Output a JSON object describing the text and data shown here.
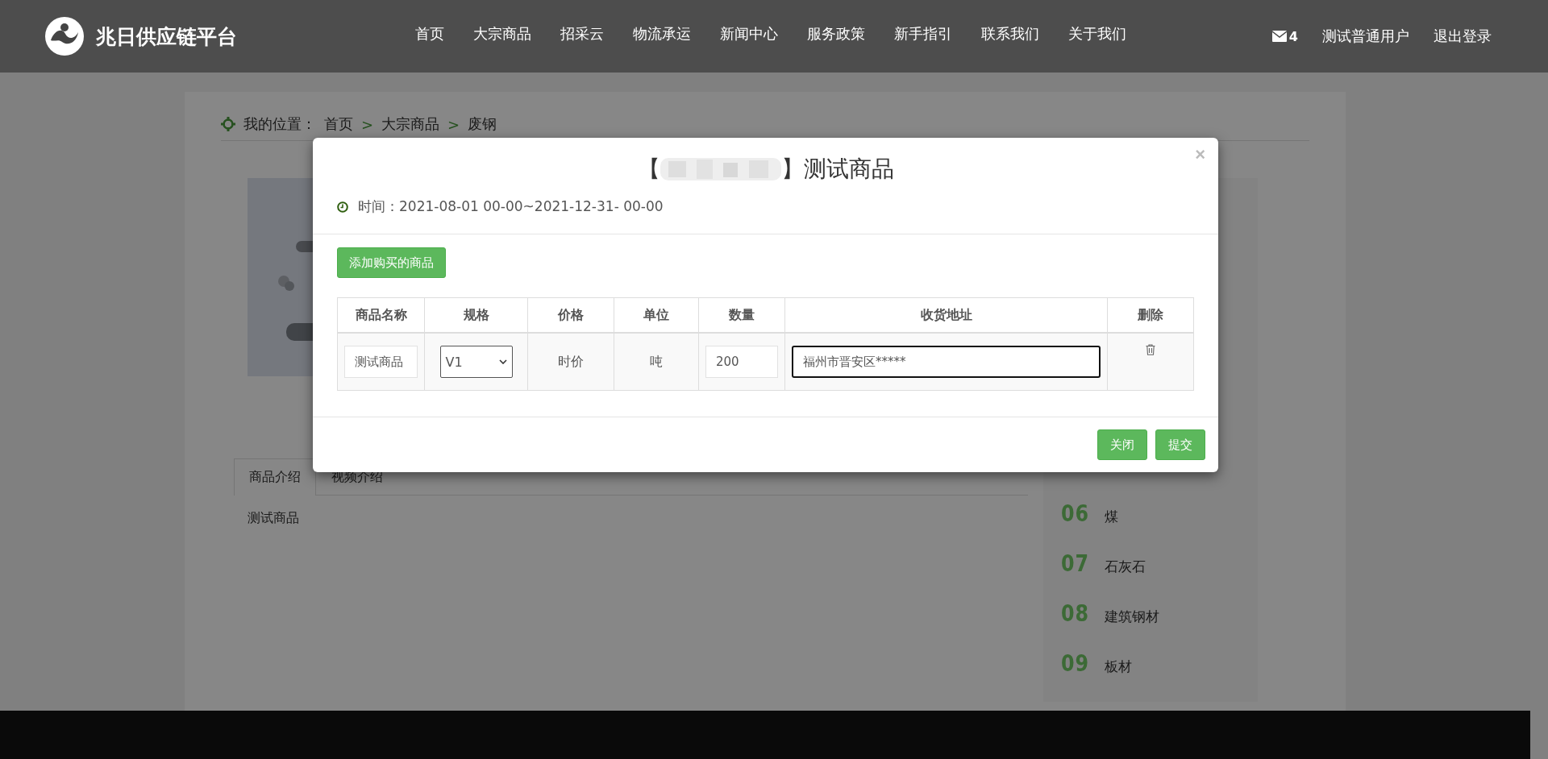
{
  "header": {
    "brand": "兆日供应链平台",
    "nav": [
      "首页",
      "大宗商品",
      "招采云",
      "物流承运",
      "新闻中心",
      "服务政策",
      "新手指引",
      "联系我们",
      "关于我们"
    ],
    "message_count": "4",
    "user": "测试普通用户",
    "logout": "退出登录"
  },
  "page": {
    "breadcrumb": {
      "label": "我的位置：",
      "trail": [
        {
          "kind": "link",
          "text": "首页"
        },
        {
          "kind": "separator",
          "text": ">"
        },
        {
          "kind": "link",
          "text": "大宗商品"
        },
        {
          "kind": "separator",
          "text": ">"
        },
        {
          "kind": "link",
          "text": "废钢"
        }
      ]
    },
    "detail_tabs": [
      {
        "label": "商品介绍",
        "selected": true
      },
      {
        "label": "视频介绍",
        "selected": false
      }
    ],
    "description": "测试商品",
    "category_list": [
      {
        "number": "06",
        "name": "煤"
      },
      {
        "number": "07",
        "name": "石灰石"
      },
      {
        "number": "08",
        "name": "建筑钢材"
      },
      {
        "number": "09",
        "name": "板材"
      }
    ]
  },
  "modal": {
    "title_open": "【",
    "title_close": "】测试商品",
    "close": "×",
    "time": "时间：2021-08-01 00-00~2021-12-31- 00-00",
    "add_button": "添加购买的商品",
    "table": {
      "columns": [
        "商品名称",
        "规格",
        "价格",
        "单位",
        "数量",
        "收货地址",
        "删除"
      ],
      "rows": [
        {
          "name": "测试商品",
          "spec": "V1",
          "price": "时价",
          "unit": "吨",
          "quantity": "200",
          "address": "福州市晋安区*****",
          "address_focused": true
        }
      ]
    },
    "buttons": [
      "关闭",
      "提交"
    ]
  }
}
